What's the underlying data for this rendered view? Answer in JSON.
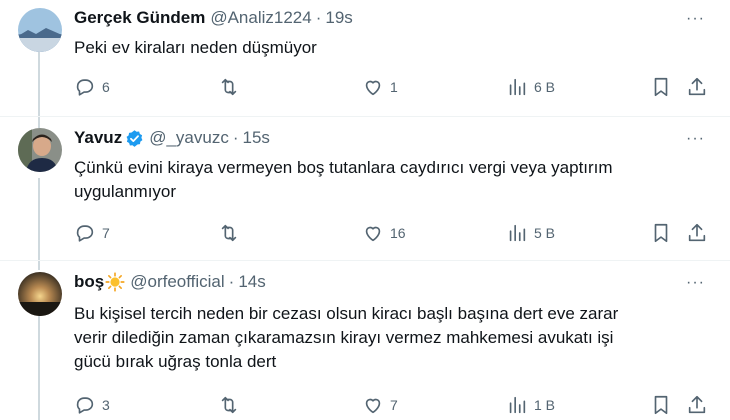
{
  "tweets": [
    {
      "name": "Gerçek Gündem",
      "handle": "@Analiz1224",
      "time": "19s",
      "text": [
        "Peki ev kiraları neden düşmüyor"
      ],
      "replies": "6",
      "retweets": "",
      "likes": "1",
      "views": "6 B"
    },
    {
      "name": "Yavuz",
      "handle": "@_yavuzc",
      "time": "15s",
      "text": [
        "Çünkü evini kiraya vermeyen boş tutanlara caydırıcı vergi veya yaptırım",
        "uygulanmıyor"
      ],
      "replies": "7",
      "retweets": "",
      "likes": "16",
      "views": "5 B"
    },
    {
      "name": "boş",
      "handle": "@orfeofficial",
      "time": "14s",
      "text": [
        "Bu kişisel tercih neden bir cezası olsun kiracı başlı başına dert eve zarar",
        "verir dilediğin zaman çıkaramazsın kirayı vermez mahkemesi avukatı işi",
        "gücü bırak uğraş tonla dert"
      ],
      "replies": "3",
      "retweets": "",
      "likes": "7",
      "views": "1 B"
    }
  ],
  "more_label": "···",
  "dot": "·",
  "colors": {
    "text": "#0f1419",
    "secondary": "#536471",
    "verified": "#1d9bf0",
    "line": "#cfd9de"
  },
  "icons": [
    "reply-icon",
    "retweet-icon",
    "like-icon",
    "views-icon",
    "bookmark-icon",
    "share-icon",
    "verified-badge-icon",
    "sun-emoji-icon",
    "more-icon"
  ]
}
